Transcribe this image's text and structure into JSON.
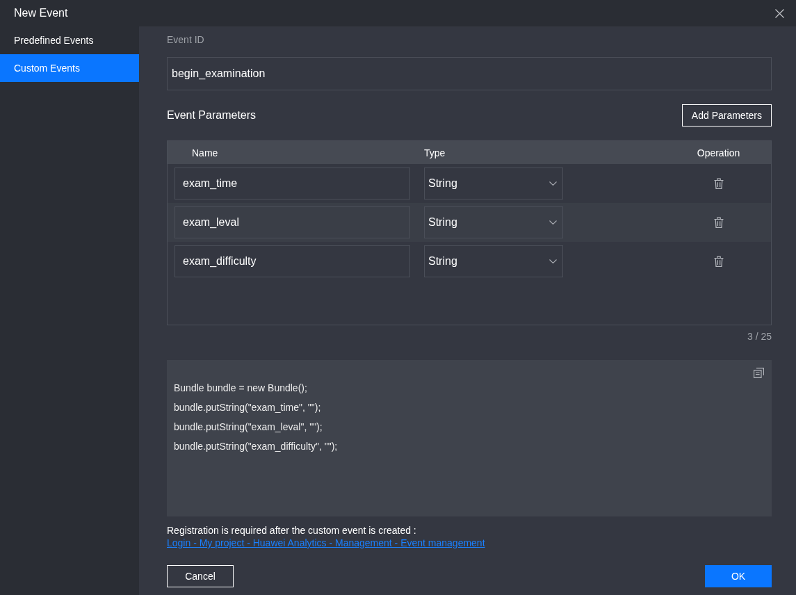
{
  "window": {
    "title": "New Event"
  },
  "sidebar": {
    "items": [
      {
        "label": "Predefined Events",
        "selected": false
      },
      {
        "label": "Custom Events",
        "selected": true
      }
    ]
  },
  "event_id": {
    "label": "Event ID",
    "value": "begin_examination"
  },
  "parameters": {
    "title": "Event Parameters",
    "add_button": "Add Parameters",
    "columns": [
      "Name",
      "Type",
      "Operation"
    ],
    "rows": [
      {
        "name": "exam_time",
        "type": "String"
      },
      {
        "name": "exam_leval",
        "type": "String"
      },
      {
        "name": "exam_difficulty",
        "type": "String"
      }
    ],
    "count": "3 / 25"
  },
  "code": {
    "lines": [
      "Bundle bundle = new Bundle();",
      "bundle.putString(\"exam_time\", \"\");",
      "bundle.putString(\"exam_leval\", \"\");",
      "bundle.putString(\"exam_difficulty\", \"\");"
    ]
  },
  "note": {
    "text": "Registration is required after the custom event is created :",
    "link": "Login - My project - Huawei Analytics - Management - Event management"
  },
  "buttons": [
    {
      "label": "Cancel",
      "kind": "secondary"
    },
    {
      "label": "OK",
      "kind": "primary"
    }
  ]
}
